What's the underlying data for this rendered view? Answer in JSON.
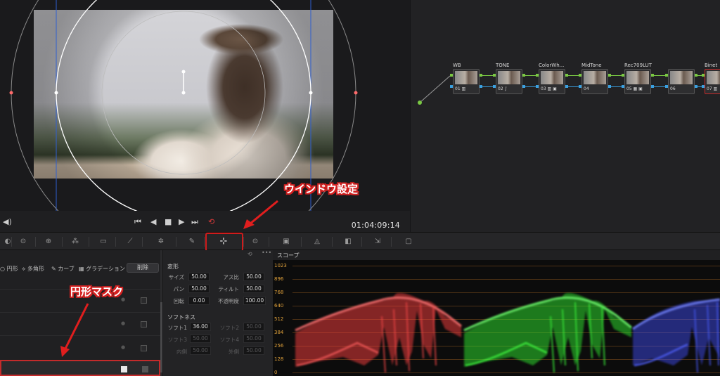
{
  "viewer": {
    "timecode": "01:04:09:14",
    "transport_icons": [
      "volume-icon",
      "skip-back-icon",
      "step-back-icon",
      "stop-icon",
      "play-icon",
      "skip-forward-icon",
      "loop-icon"
    ]
  },
  "nodes": [
    {
      "label": "WB",
      "num": "01 ▥"
    },
    {
      "label": "TONE",
      "num": "02 ∫"
    },
    {
      "label": "ColorWh...",
      "num": "03 ▥ ▣"
    },
    {
      "label": "MidTone",
      "num": "04"
    },
    {
      "label": "Rec709LUT",
      "num": "05 ▦ ▣"
    },
    {
      "label": "",
      "num": "06"
    },
    {
      "label": "Binet",
      "num": "07 ▥"
    }
  ],
  "window_panel": {
    "tabs": [
      "円形",
      "多角形",
      "カーブ",
      "グラデーション"
    ],
    "reset_label": "削除"
  },
  "transform": {
    "section_title": "変形",
    "size_label": "サイズ",
    "size": "50.00",
    "aspect_label": "アス比",
    "aspect": "50.00",
    "pan_label": "パン",
    "pan": "50.00",
    "tilt_label": "ティルト",
    "tilt": "50.00",
    "rotate_label": "回転",
    "rotate": "0.00",
    "opacity_label": "不透明度",
    "opacity": "100.00",
    "softness_title": "ソフトネス",
    "soft1_label": "ソフト1",
    "soft1": "36.00",
    "soft2_label": "ソフト2",
    "soft2": "50.00",
    "soft3_label": "ソフト3",
    "soft3": "50.00",
    "soft4_label": "ソフト4",
    "soft4": "50.00",
    "inside_label": "内側",
    "inside": "50.00",
    "outside_label": "外側",
    "outside": "50.00"
  },
  "scope": {
    "title": "スコープ",
    "y_labels": [
      "1023",
      "896",
      "768",
      "640",
      "512",
      "384",
      "256",
      "128",
      "0"
    ]
  },
  "annotations": {
    "window_settings": "ウインドウ設定",
    "circle_mask": "円形マスク"
  },
  "colors": {
    "highlight": "#d01c1c",
    "node_pin_green": "#7ac943",
    "node_pin_blue": "#3aa0e0",
    "scope_red": "#ff4a4a",
    "scope_green": "#3cff3c",
    "scope_blue": "#4a5cff"
  }
}
